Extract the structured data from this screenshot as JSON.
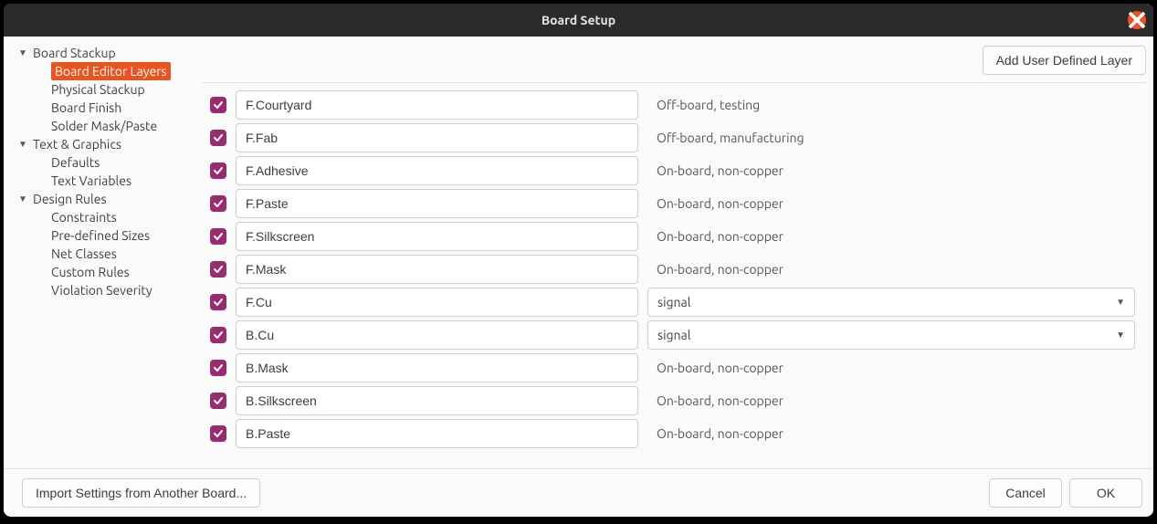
{
  "window": {
    "title": "Board Setup"
  },
  "sidebar": {
    "groups": [
      {
        "label": "Board Stackup",
        "items": [
          {
            "label": "Board Editor Layers",
            "selected": true
          },
          {
            "label": "Physical Stackup"
          },
          {
            "label": "Board Finish"
          },
          {
            "label": "Solder Mask/Paste"
          }
        ]
      },
      {
        "label": "Text & Graphics",
        "items": [
          {
            "label": "Defaults"
          },
          {
            "label": "Text Variables"
          }
        ]
      },
      {
        "label": "Design Rules",
        "items": [
          {
            "label": "Constraints"
          },
          {
            "label": "Pre-defined Sizes"
          },
          {
            "label": "Net Classes"
          },
          {
            "label": "Custom Rules"
          },
          {
            "label": "Violation Severity"
          }
        ]
      }
    ]
  },
  "toolbar": {
    "add_layer_label": "Add User Defined Layer"
  },
  "layers": [
    {
      "name": "F.Courtyard",
      "type": "Off-board, testing",
      "checked": true,
      "kind": "text"
    },
    {
      "name": "F.Fab",
      "type": "Off-board, manufacturing",
      "checked": true,
      "kind": "text"
    },
    {
      "name": "F.Adhesive",
      "type": "On-board, non-copper",
      "checked": true,
      "kind": "text"
    },
    {
      "name": "F.Paste",
      "type": "On-board, non-copper",
      "checked": true,
      "kind": "text"
    },
    {
      "name": "F.Silkscreen",
      "type": "On-board, non-copper",
      "checked": true,
      "kind": "text"
    },
    {
      "name": "F.Mask",
      "type": "On-board, non-copper",
      "checked": true,
      "kind": "text"
    },
    {
      "name": "F.Cu",
      "type": "signal",
      "checked": true,
      "kind": "select"
    },
    {
      "name": "B.Cu",
      "type": "signal",
      "checked": true,
      "kind": "select"
    },
    {
      "name": "B.Mask",
      "type": "On-board, non-copper",
      "checked": true,
      "kind": "text"
    },
    {
      "name": "B.Silkscreen",
      "type": "On-board, non-copper",
      "checked": true,
      "kind": "text"
    },
    {
      "name": "B.Paste",
      "type": "On-board, non-copper",
      "checked": true,
      "kind": "text"
    }
  ],
  "footer": {
    "import_label": "Import Settings from Another Board...",
    "cancel_label": "Cancel",
    "ok_label": "OK"
  }
}
